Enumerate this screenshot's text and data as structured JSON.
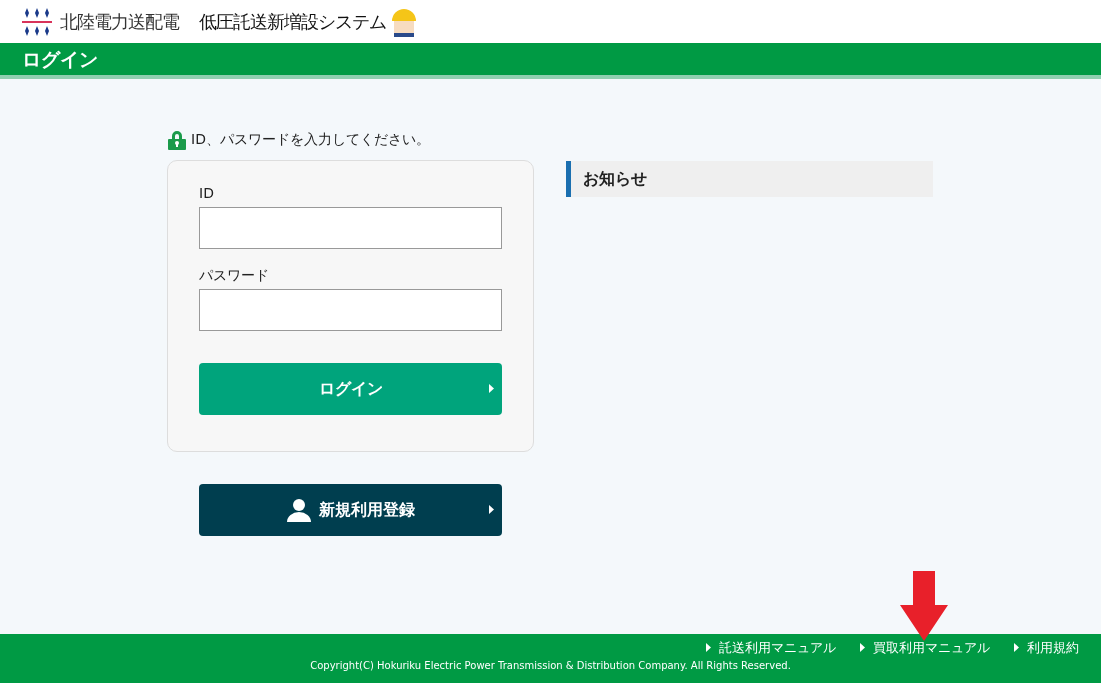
{
  "header": {
    "company": "北陸電力送配電",
    "system": "低圧託送新増設システム"
  },
  "page_title": "ログイン",
  "login": {
    "instruction": "ID、パスワードを入力してください。",
    "fields": [
      {
        "label": "ID"
      },
      {
        "label": "パスワード"
      }
    ],
    "submit": "ログイン"
  },
  "register_button": "新規利用登録",
  "notices": {
    "title": "お知らせ"
  },
  "footer": {
    "links": [
      "託送利用マニュアル",
      "買取利用マニュアル",
      "利用規約"
    ],
    "copyright": "Copyright(C) Hokuriku Electric Power Transmission & Distribution Company. All Rights Reserved."
  }
}
